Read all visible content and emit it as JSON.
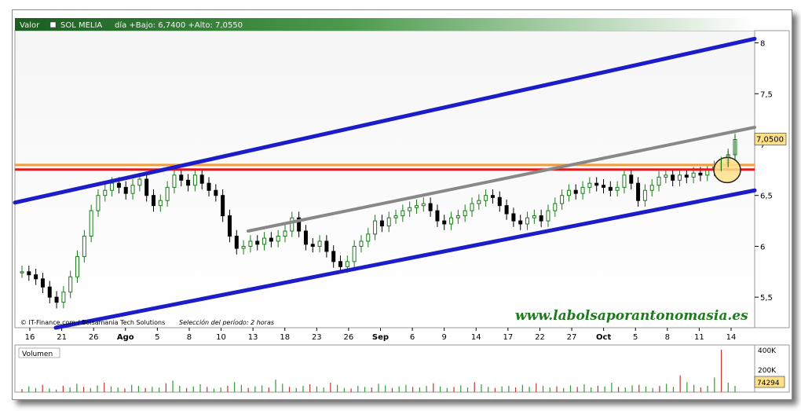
{
  "header": {
    "valor_label": "Valor",
    "ticker": "SOL MELIA",
    "stats": "día +Bajo: 6,7400 +Alto: 7,0550"
  },
  "credits": {
    "source": "© IT-Finance.com / Bolsamania Tech Solutions",
    "period": "Selección del período: 2 horas"
  },
  "watermark": "www.labolsaporantonomasia.es",
  "volume": {
    "label": "Volumen",
    "ticks": [
      "400K",
      "200K"
    ],
    "last_value": "74294",
    "last_value_num": 74294
  },
  "colors": {
    "header_bg": "#2e7d32",
    "price_up": "#1a7a1a",
    "price_down": "#000000",
    "channel": "#1c1cc8",
    "mid_line": "#888888",
    "resistance_red": "#e41a1a",
    "resistance_orange": "#f39c3a",
    "current_box": "#ffe08a",
    "volume_bar": "#2e9e2e"
  },
  "chart_data": {
    "type": "candlestick",
    "y_axis": {
      "ylim": [
        5.2,
        8.12
      ],
      "ticks": [
        5.5,
        6,
        6.5,
        7,
        7.5,
        8
      ],
      "tick_labels": [
        "5,5",
        "6",
        "6,5",
        "7",
        "7,5",
        "8"
      ],
      "position": "right"
    },
    "x_axis": {
      "labels": [
        {
          "text": "16",
          "bold": false
        },
        {
          "text": "21",
          "bold": false
        },
        {
          "text": "26",
          "bold": false
        },
        {
          "text": "Ago",
          "bold": true
        },
        {
          "text": "5",
          "bold": false
        },
        {
          "text": "8",
          "bold": false
        },
        {
          "text": "10",
          "bold": false
        },
        {
          "text": "13",
          "bold": false
        },
        {
          "text": "18",
          "bold": false
        },
        {
          "text": "23",
          "bold": false
        },
        {
          "text": "26",
          "bold": false
        },
        {
          "text": "Sep",
          "bold": true
        },
        {
          "text": "6",
          "bold": false
        },
        {
          "text": "9",
          "bold": false
        },
        {
          "text": "14",
          "bold": false
        },
        {
          "text": "17",
          "bold": false
        },
        {
          "text": "22",
          "bold": false
        },
        {
          "text": "27",
          "bold": false
        },
        {
          "text": "Oct",
          "bold": true
        },
        {
          "text": "5",
          "bold": false
        },
        {
          "text": "8",
          "bold": false
        },
        {
          "text": "11",
          "bold": false
        },
        {
          "text": "14",
          "bold": false
        }
      ]
    },
    "current_value": 7.05,
    "current_value_label": "7,0500",
    "day_low": 6.74,
    "day_high": 7.055,
    "price_path": [
      5.75,
      5.72,
      5.68,
      5.6,
      5.5,
      5.45,
      5.55,
      5.7,
      5.9,
      6.1,
      6.35,
      6.5,
      6.55,
      6.62,
      6.58,
      6.52,
      6.6,
      6.66,
      6.5,
      6.4,
      6.45,
      6.58,
      6.7,
      6.65,
      6.6,
      6.7,
      6.62,
      6.55,
      6.5,
      6.3,
      6.1,
      5.98,
      6.0,
      6.05,
      6.02,
      6.08,
      6.05,
      6.1,
      6.15,
      6.28,
      6.15,
      6.02,
      6.0,
      6.05,
      5.95,
      5.85,
      5.8,
      5.85,
      6.0,
      6.05,
      6.12,
      6.25,
      6.2,
      6.28,
      6.3,
      6.35,
      6.38,
      6.4,
      6.42,
      6.35,
      6.25,
      6.22,
      6.28,
      6.3,
      6.35,
      6.42,
      6.45,
      6.5,
      6.48,
      6.4,
      6.32,
      6.25,
      6.22,
      6.28,
      6.3,
      6.25,
      6.35,
      6.42,
      6.5,
      6.55,
      6.52,
      6.58,
      6.62,
      6.6,
      6.58,
      6.55,
      6.58,
      6.7,
      6.62,
      6.45,
      6.55,
      6.6,
      6.68,
      6.7,
      6.65,
      6.7,
      6.68,
      6.72,
      6.7,
      6.75,
      6.78,
      6.82,
      6.9,
      7.05
    ],
    "volume_values": [
      30,
      55,
      40,
      70,
      35,
      25,
      60,
      45,
      80,
      50,
      40,
      65,
      90,
      55,
      45,
      35,
      70,
      60,
      40,
      50,
      45,
      85,
      110,
      60,
      40,
      55,
      75,
      50,
      35,
      45,
      60,
      95,
      70,
      40,
      55,
      65,
      45,
      120,
      80,
      50,
      40,
      60,
      75,
      55,
      45,
      90,
      70,
      40,
      35,
      60,
      50,
      45,
      80,
      65,
      40,
      55,
      70,
      50,
      45,
      60,
      85,
      55,
      40,
      50,
      65,
      45,
      95,
      75,
      50,
      40,
      55,
      60,
      45,
      70,
      50,
      85,
      60,
      45,
      55,
      40,
      65,
      50,
      75,
      45,
      60,
      55,
      90,
      50,
      45,
      65,
      70,
      55,
      40,
      60,
      80,
      50,
      160,
      95,
      70,
      45,
      60,
      140,
      405,
      90,
      60
    ]
  }
}
